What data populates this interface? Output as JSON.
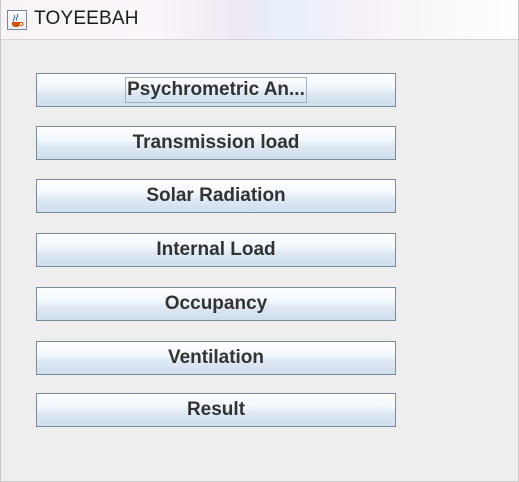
{
  "window": {
    "title": "TOYEEBAH"
  },
  "buttons": {
    "psychrometric": "Psychrometric An...",
    "transmission": "Transmission load",
    "solar": "Solar Radiation",
    "internal": "Internal Load",
    "occupancy": "Occupancy",
    "ventilation": "Ventilation",
    "result": "Result"
  },
  "icons": {
    "app": "java-coffee-cup-icon"
  }
}
